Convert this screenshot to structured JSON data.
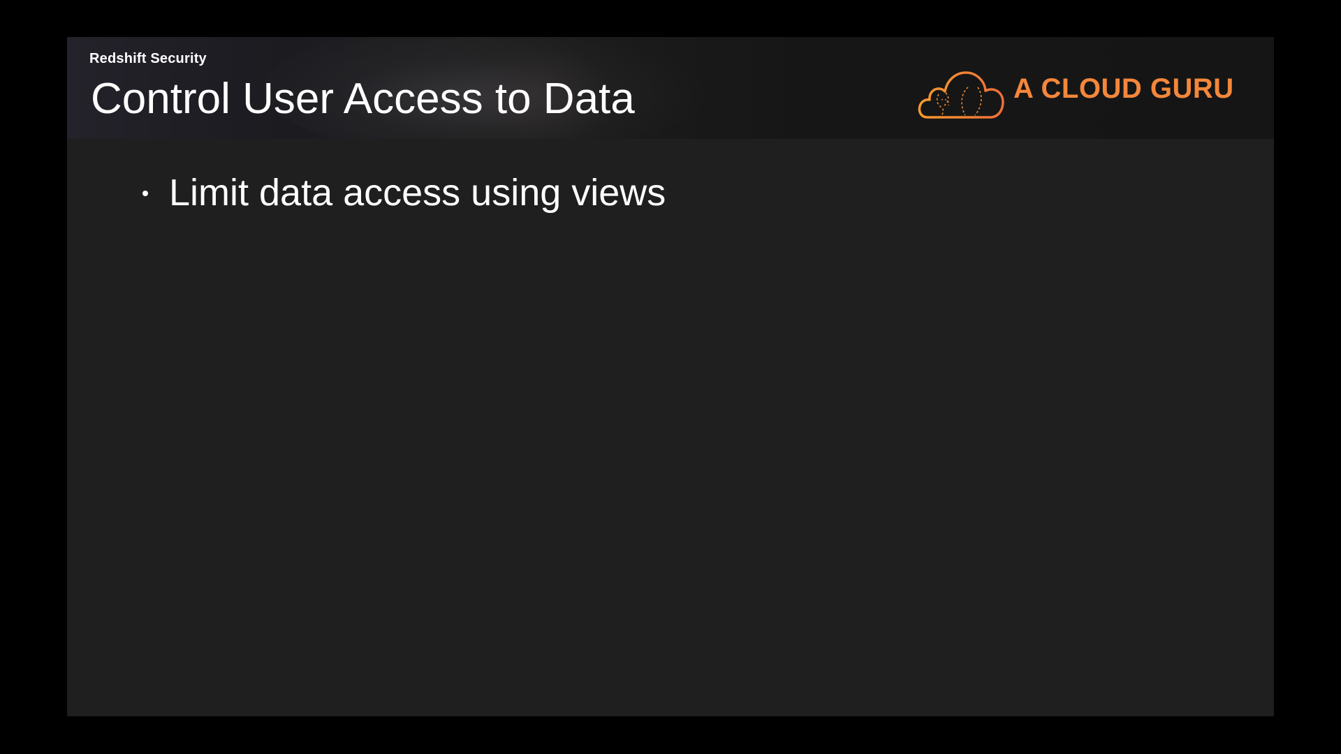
{
  "slide": {
    "subtitle": "Redshift Security",
    "title": "Control User Access to Data",
    "logo": {
      "icon": "cloud-logo-icon",
      "text": "A CLOUD GURU",
      "color": "#f4873a"
    },
    "bullets": [
      {
        "text": "Limit data access using views"
      }
    ]
  },
  "colors": {
    "frame": "#000000",
    "slide_background": "#1f1f1f",
    "header_background": "#161616",
    "text": "#ffffff",
    "accent": "#f4873a"
  }
}
